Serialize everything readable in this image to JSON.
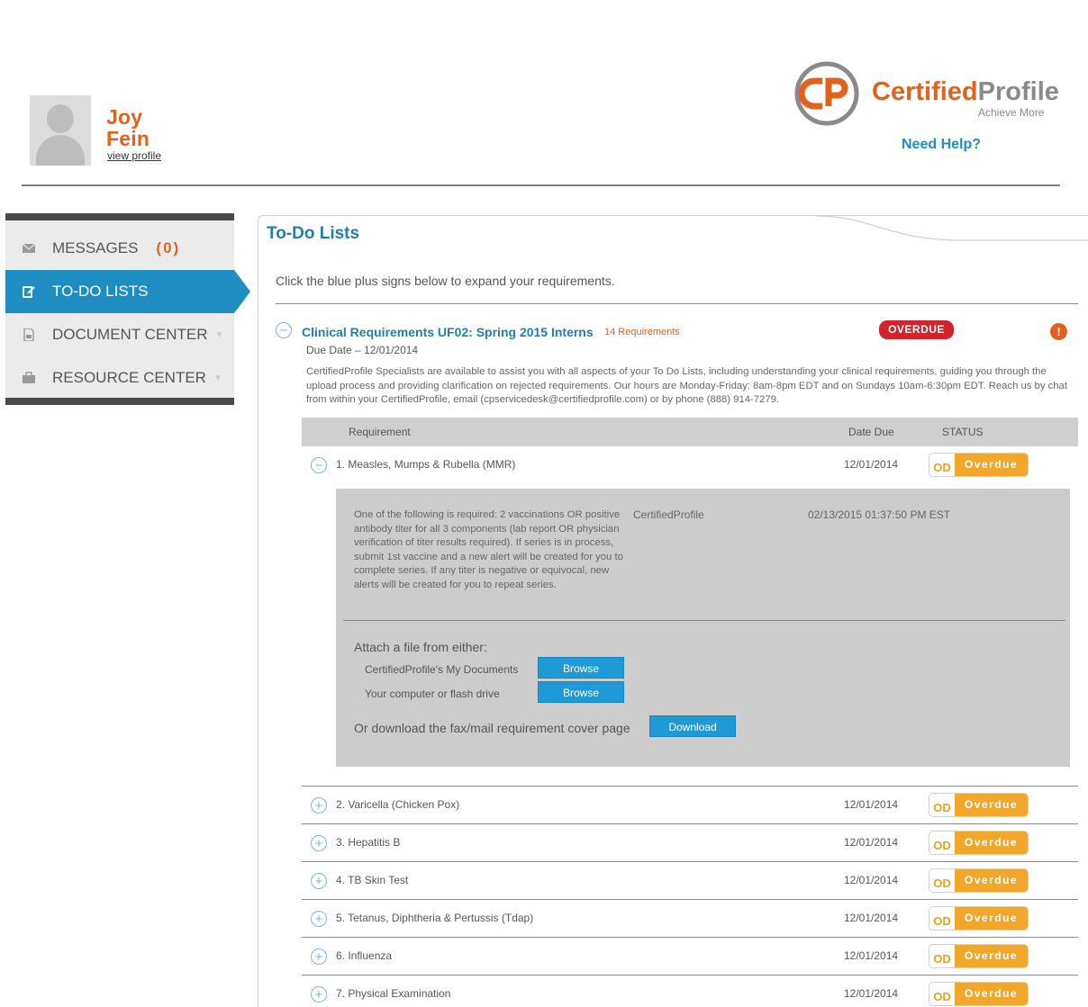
{
  "user": {
    "first_name": "Joy",
    "last_name": "Fein",
    "profile_link": "view profile"
  },
  "brand": {
    "name_part1": "Certified",
    "name_part2": "Profile",
    "tagline": "Achieve More",
    "help_link": "Need Help?",
    "colors": {
      "orange": "#e3611d",
      "blue": "#1e8dc1"
    }
  },
  "sidebar": {
    "items": [
      {
        "label": "MESSAGES",
        "count": "(0)",
        "icon": "envelope-icon"
      },
      {
        "label": "TO-DO LISTS",
        "icon": "edit-icon"
      },
      {
        "label": "DOCUMENT CENTER",
        "icon": "document-icon"
      },
      {
        "label": "RESOURCE CENTER",
        "icon": "briefcase-icon"
      }
    ]
  },
  "main": {
    "title": "To-Do Lists",
    "instructions": "Click the blue plus signs below to expand your requirements.",
    "group": {
      "title": "Clinical Requirements UF02: Spring 2015 Interns",
      "count": "14 Requirements",
      "badge": "OVERDUE",
      "due_date": "Due Date – 12/01/2014",
      "description": "CertifiedProfile Specialists are available to assist you with all aspects of your To Do Lists, including understanding your clinical requirements, guiding you through the upload process and providing clarification on rejected requirements. Our hours are Monday-Friday: 8am-8pm EDT and on Sundays 10am-6:30pm EDT. Reach us by chat from within your CertifiedProfile, email (cpservicedesk@certifiedprofile.com) or by phone (888) 914-7279."
    },
    "table": {
      "headers": {
        "requirement": "Requirement",
        "date_due": "Date Due",
        "status": "STATUS"
      },
      "status_short": "OD",
      "status_label": "Overdue",
      "rows": [
        {
          "name": "1. Measles, Mumps & Rubella (MMR)",
          "date": "12/01/2014"
        },
        {
          "name": "2. Varicella (Chicken Pox)",
          "date": "12/01/2014"
        },
        {
          "name": "3. Hepatitis B",
          "date": "12/01/2014"
        },
        {
          "name": "4. TB Skin Test",
          "date": "12/01/2014"
        },
        {
          "name": "5. Tetanus, Diphtheria & Pertussis (Tdap)",
          "date": "12/01/2014"
        },
        {
          "name": "6. Influenza",
          "date": "12/01/2014"
        },
        {
          "name": "7. Physical Examination",
          "date": "12/01/2014"
        }
      ]
    },
    "detail": {
      "text": "One of the following is required: 2 vaccinations OR positive antibody titer for all 3 components (lab report OR physician verification of titer results required). If series is in process, submit 1st vaccine and a new alert will be created for you to complete series. If any titer is negative or equivocal, new alerts will be created for you to repeat series.",
      "source": "CertifiedProfile",
      "timestamp": "02/13/2015 01:37:50 PM EST",
      "attach_title": "Attach a file from either:",
      "option1_label": "CertifiedProfile's My Documents",
      "option2_label": "Your computer or flash drive",
      "browse_label": "Browse",
      "download_prompt": "Or download the fax/mail requirement cover page",
      "download_label": "Download"
    }
  }
}
